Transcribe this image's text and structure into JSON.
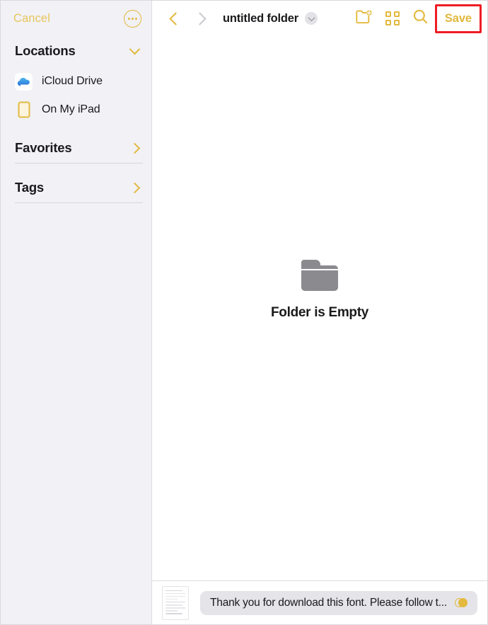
{
  "colors": {
    "accent": "#e3b93e",
    "accent_text": "#e0b83c",
    "highlight_red": "#ee1c24",
    "sidebar_bg": "#f1f1f6",
    "content_bg": "#ffffff",
    "empty_icon": "#8a8a8f",
    "field_bg": "#e4e4e9"
  },
  "sidebar": {
    "cancel_label": "Cancel",
    "more_icon": "ellipsis-circle-icon",
    "sections": [
      {
        "title": "Locations",
        "disclosure_icon": "chevron-down-icon",
        "expanded": true,
        "items": [
          {
            "label": "iCloud Drive",
            "icon": "icloud-icon"
          },
          {
            "label": "On My iPad",
            "icon": "ipad-icon"
          }
        ]
      },
      {
        "title": "Favorites",
        "disclosure_icon": "chevron-right-icon",
        "expanded": false,
        "items": []
      },
      {
        "title": "Tags",
        "disclosure_icon": "chevron-right-icon",
        "expanded": false,
        "items": []
      }
    ]
  },
  "toolbar": {
    "back_icon": "chevron-left-icon",
    "back_enabled": true,
    "forward_icon": "chevron-right-icon",
    "forward_enabled": false,
    "folder_title": "untitled folder",
    "title_menu_icon": "chevron-down-circle-icon",
    "new_folder_icon": "new-folder-icon",
    "view_grid_icon": "grid-view-icon",
    "search_icon": "search-icon",
    "save_label": "Save",
    "save_highlighted": true
  },
  "main": {
    "empty_icon": "folder-icon",
    "empty_text": "Folder is Empty"
  },
  "bottom": {
    "thumbnail_icon": "document-thumbnail-icon",
    "filename_value": "Thank you for download this font. Please follow t...",
    "filename_placeholder": "Name",
    "tags_icon": "tags-icon"
  }
}
